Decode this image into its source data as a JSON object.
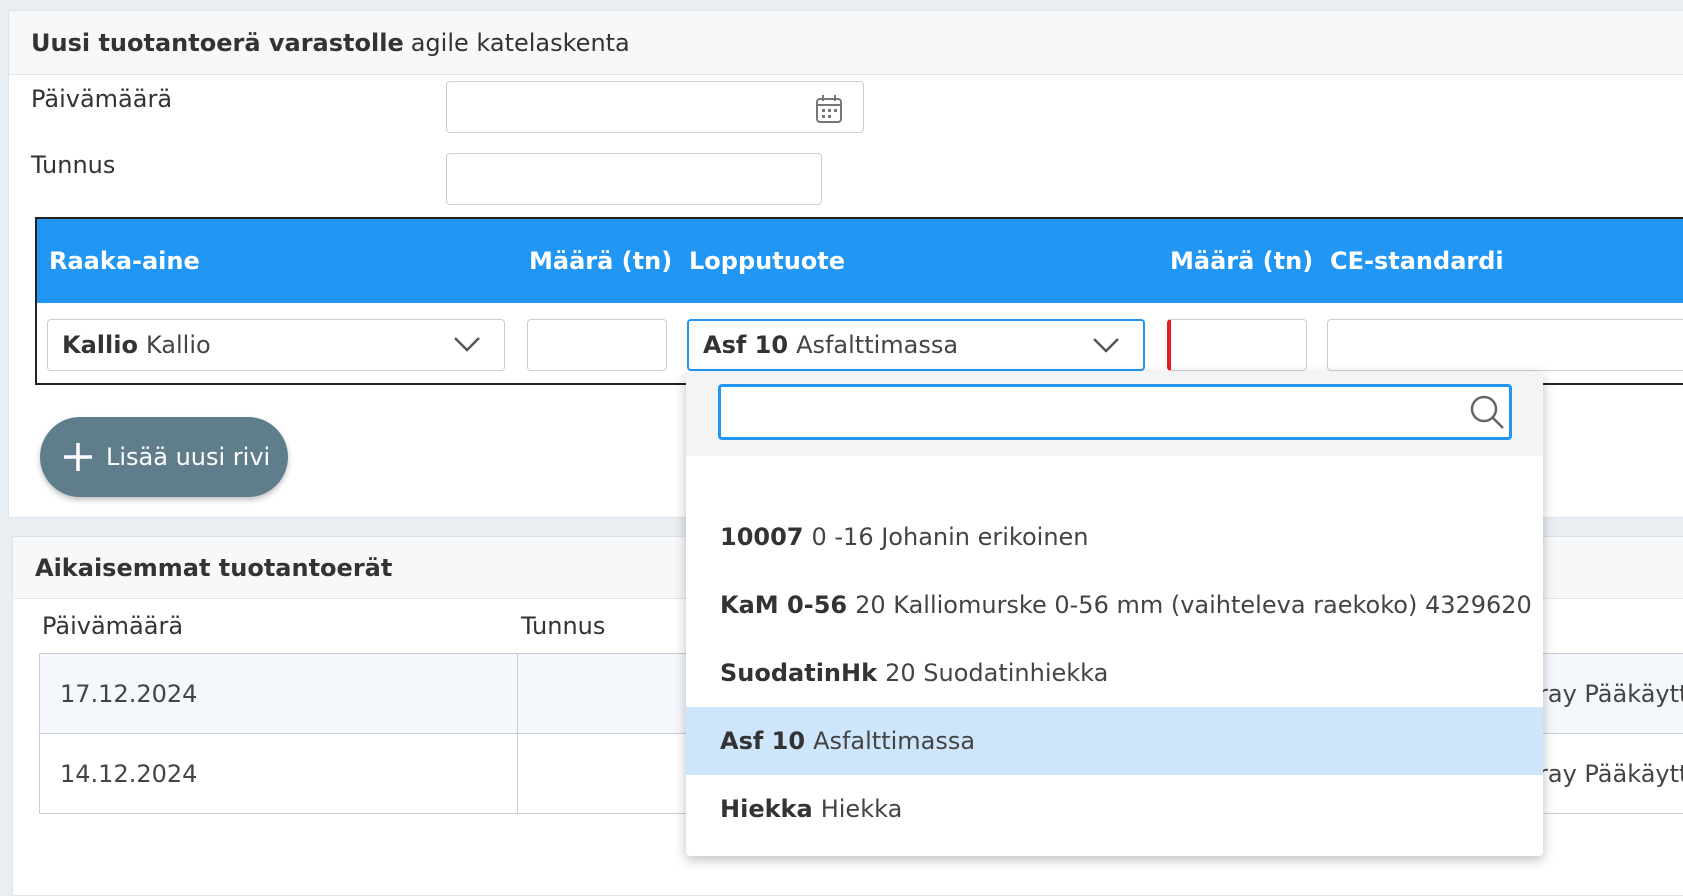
{
  "form": {
    "title_bold": "Uusi tuotantoerä varastolle",
    "title_rest": "agile katelaskenta",
    "date_label": "Päivämäärä",
    "id_label": "Tunnus",
    "date_value": "",
    "id_value": ""
  },
  "grid": {
    "columns": [
      "Raaka-aine",
      "Määrä (tn)",
      "Lopputuote",
      "Määrä (tn)",
      "CE-standardi"
    ],
    "row": {
      "raw_material_code": "Kallio",
      "raw_material_name": "Kallio",
      "product_code": "Asf 10",
      "product_name": "Asfalttimassa"
    }
  },
  "add_row_button": "Lisää uusi rivi",
  "history": {
    "title": "Aikaisemmat tuotantoerät",
    "columns": [
      "Päivämäärä",
      "Tunnus"
    ],
    "rows": [
      {
        "date": "17.12.2024",
        "id": "",
        "user": "ray Pääkäytt"
      },
      {
        "date": "14.12.2024",
        "id": "",
        "user": "ray Pääkäytt"
      }
    ]
  },
  "dropdown": {
    "search_value": "",
    "options": [
      {
        "code": "10007",
        "name": "0 -16 Johanin erikoinen"
      },
      {
        "code": "KaM 0-56",
        "name": "20 Kalliomurske 0-56 mm (vaihteleva raekoko) 4329620"
      },
      {
        "code": "SuodatinHk",
        "name": "20 Suodatinhiekka"
      },
      {
        "code": "Asf 10",
        "name": "Asfalttimassa"
      },
      {
        "code": "Hiekka",
        "name": "Hiekka"
      }
    ],
    "highlighted_index": 3
  },
  "colors": {
    "accent": "#2196f3",
    "button": "#607d8b",
    "highlight": "#cde6fb",
    "error": "#e51c23"
  }
}
